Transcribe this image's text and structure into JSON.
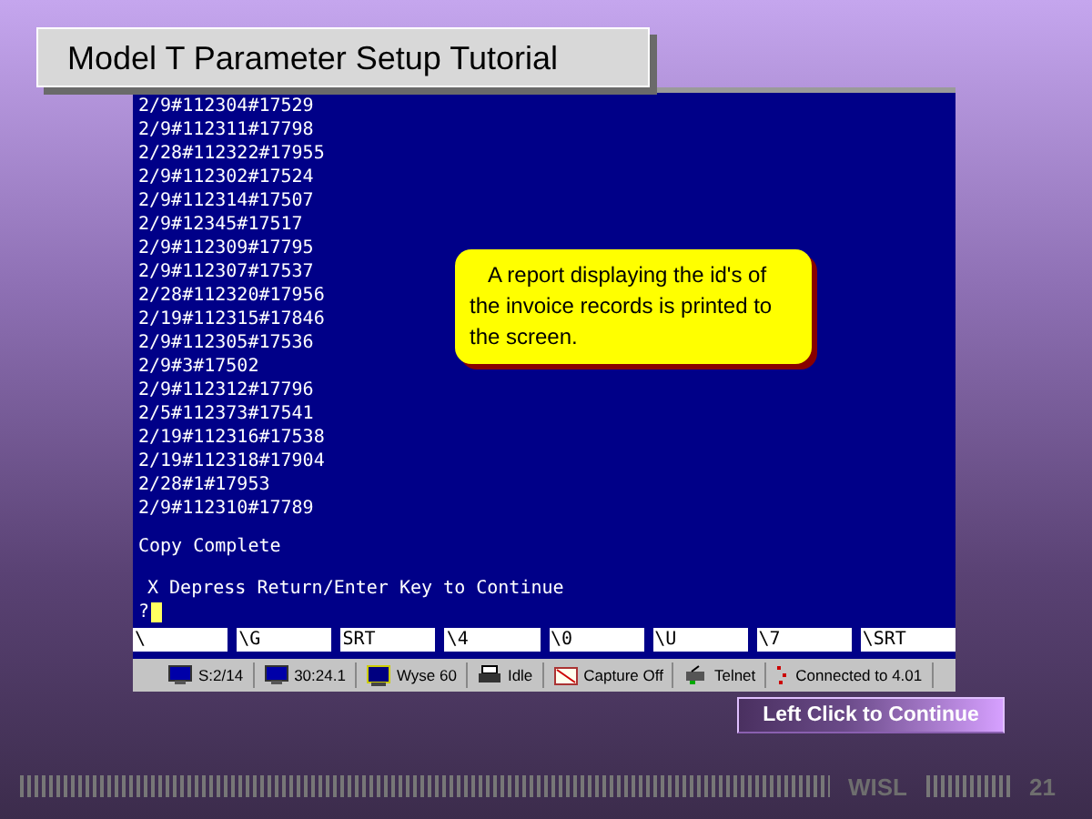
{
  "slide_title": "Model T Parameter Setup Tutorial",
  "terminal": {
    "report_lines": [
      "2/9#112304#17529",
      "2/9#112311#17798",
      "2/28#112322#17955",
      "2/9#112302#17524",
      "2/9#112314#17507",
      "2/9#12345#17517",
      "2/9#112309#17795",
      "2/9#112307#17537",
      "2/28#112320#17956",
      "2/19#112315#17846",
      "2/9#112305#17536",
      "2/9#3#17502",
      "2/9#112312#17796",
      "2/5#112373#17541",
      "2/19#112316#17538",
      "2/19#112318#17904",
      "2/28#1#17953",
      "2/9#112310#17789"
    ],
    "status": "Copy Complete",
    "message": "X Depress Return/Enter Key to Continue",
    "prompt": "?",
    "function_keys": [
      "\\",
      "\\G",
      "SRT",
      "\\4",
      "\\0",
      "\\U",
      "\\7",
      "\\SRT"
    ]
  },
  "taskbar": [
    {
      "kind": "monitor",
      "label": "S:2/14"
    },
    {
      "kind": "monitor",
      "label": "30:24.1"
    },
    {
      "kind": "terminal",
      "label": "Wyse 60"
    },
    {
      "kind": "printer",
      "label": "Idle"
    },
    {
      "kind": "capture",
      "label": "Capture Off"
    },
    {
      "kind": "network",
      "label": "Telnet"
    },
    {
      "kind": "link",
      "label": "Connected to 4.01"
    }
  ],
  "callout": "A report displaying the id's of the invoice records is printed to the screen.",
  "continue_button": "Left Click to Continue",
  "footer": {
    "brand": "WISL",
    "page": "21"
  }
}
